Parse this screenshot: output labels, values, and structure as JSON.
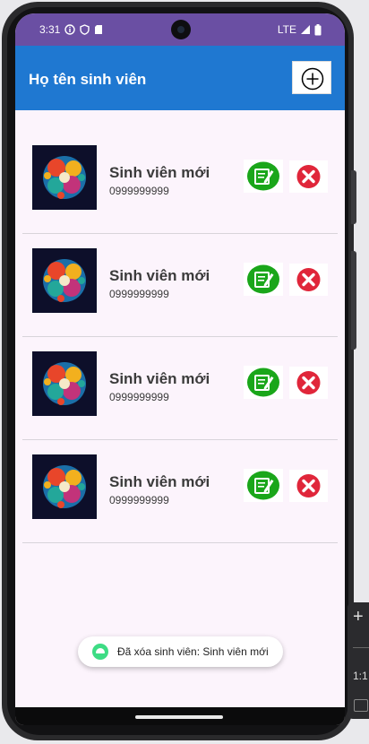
{
  "status_bar": {
    "time": "3:31",
    "network": "LTE"
  },
  "app_bar": {
    "title": "Họ tên sinh viên"
  },
  "students": [
    {
      "name": "Sinh viên mới",
      "phone": "0999999999"
    },
    {
      "name": "Sinh viên mới",
      "phone": "0999999999"
    },
    {
      "name": "Sinh viên mới",
      "phone": "0999999999"
    },
    {
      "name": "Sinh viên mới",
      "phone": "0999999999"
    }
  ],
  "toast": {
    "message": "Đã xóa sinh viên: Sinh viên mới"
  },
  "emulator_panel": {
    "plus": "+",
    "ratio": "1:1"
  },
  "colors": {
    "app_bar": "#1f78d1",
    "status_bar": "#6a4fa3",
    "edit_green": "#1aa61a",
    "delete_red": "#e0263a",
    "background": "#fcf4fc"
  }
}
